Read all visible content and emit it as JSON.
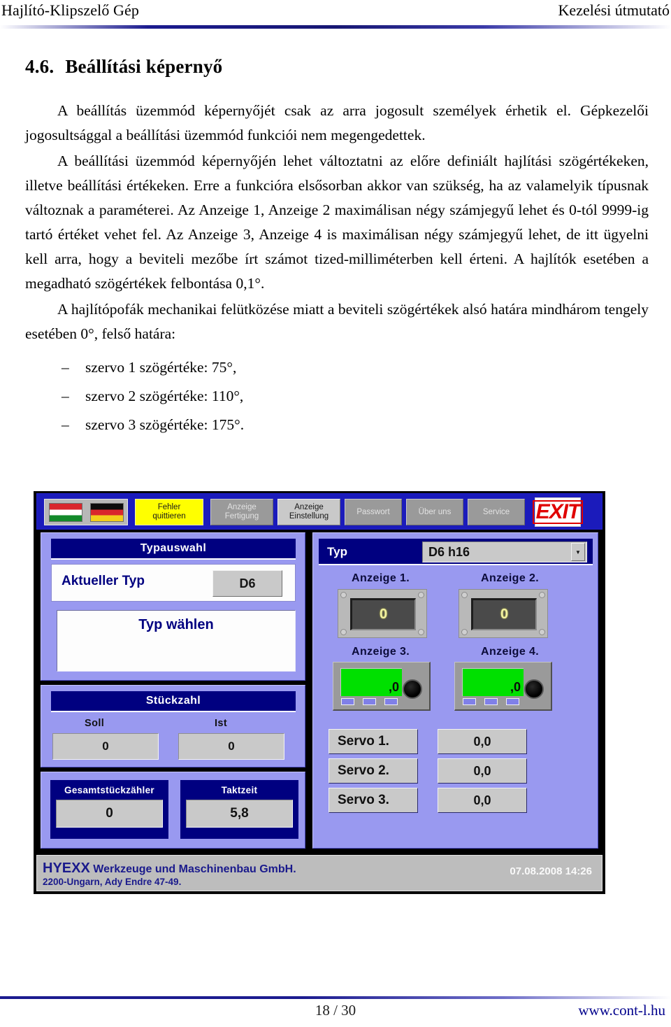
{
  "page_header": {
    "left": "Hajlító-Klipszelő Gép",
    "right": "Kezelési útmutató"
  },
  "section": {
    "number": "4.6.",
    "title": "Beállítási képernyő",
    "paragraphs": [
      "A beállítás üzemmód képernyőjét csak az arra jogosult személyek érhetik el. Gépkezelői jogosultsággal a beállítási üzemmód funkciói nem megengedettek.",
      "A beállítási üzemmód képernyőjén lehet változtatni az előre definiált hajlítási szögértékeken, illetve beállítási értékeken. Erre a funkcióra elsősorban akkor van szükség, ha az valamelyik típusnak változnak a paraméterei. Az Anzeige 1, Anzeige 2 maximálisan négy számjegyű lehet és 0-tól 9999-ig tartó értéket vehet fel. Az Anzeige 3, Anzeige 4 is maximálisan négy számjegyű lehet, de itt ügyelni kell arra, hogy a beviteli mezőbe írt számot tized-milliméterben kell érteni. A hajlítók esetében a megadható szögértékek felbontása 0,1°.",
      "A hajlítópofák mechanikai felütközése miatt a beviteli szögértékek alsó határa mindhárom tengely esetében 0°, felső határa:"
    ],
    "list_items": [
      "szervo 1 szögértéke: 75°,",
      "szervo 2 szögértéke: 110°,",
      "szervo 3 szögértéke: 175°."
    ],
    "list_dash": "–"
  },
  "hmi": {
    "toolbar": {
      "flag_hu": "hungary-flag",
      "flag_de": "germany-flag",
      "fehler_quittieren": "Fehler\nquittieren",
      "anzeige_fertigung": "Anzeige\nFertigung",
      "anzeige_einstellung": "Anzeige\nEinstellung",
      "passwort": "Passwort",
      "ueber_uns": "Über uns",
      "service": "Service",
      "exit": "EXIT"
    },
    "typauswahl": {
      "title": "Typauswahl",
      "aktueller_typ_label": "Aktueller Typ",
      "aktueller_typ_value": "D6",
      "typ_waehlen_label": "Typ wählen"
    },
    "stuckzahl": {
      "title": "Stückzahl",
      "soll_label": "Soll",
      "soll_value": "0",
      "ist_label": "Ist",
      "ist_value": "0"
    },
    "counters": {
      "gesamt_label": "Gesamtstückzähler",
      "gesamt_value": "0",
      "taktzeit_label": "Taktzeit",
      "taktzeit_value": "5,8"
    },
    "right": {
      "typ_label": "Typ",
      "typ_selected": "D6 h16",
      "anzeige1_label": "Anzeige 1.",
      "anzeige1_value": "0",
      "anzeige2_label": "Anzeige 2.",
      "anzeige2_value": "0",
      "anzeige3_label": "Anzeige 3.",
      "anzeige3_value": ",0",
      "anzeige4_label": "Anzeige 4.",
      "anzeige4_value": ",0",
      "servos": [
        {
          "name": "Servo 1.",
          "value": "0,0"
        },
        {
          "name": "Servo 2.",
          "value": "0,0"
        },
        {
          "name": "Servo 3.",
          "value": "0,0"
        }
      ]
    },
    "status": {
      "company_bold": "HYEXX",
      "company_rest": " Werkzeuge und Maschinenbau GmbH.",
      "address": "2200-Ungarn, Ady Endre 47-49.",
      "datetime": "07.08.2008 14:26"
    },
    "colors": {
      "panel_blue": "#9999f0",
      "title_blue": "#000080",
      "toolbar_blue": "#1b1bbb",
      "alarm_yellow": "#ffff00",
      "exit_red": "#e00000",
      "lcd_green": "#00e000",
      "display_amber": "#f2f2a0"
    }
  },
  "page_footer": {
    "page": "18 / 30",
    "url": "www.cont-l.hu"
  }
}
